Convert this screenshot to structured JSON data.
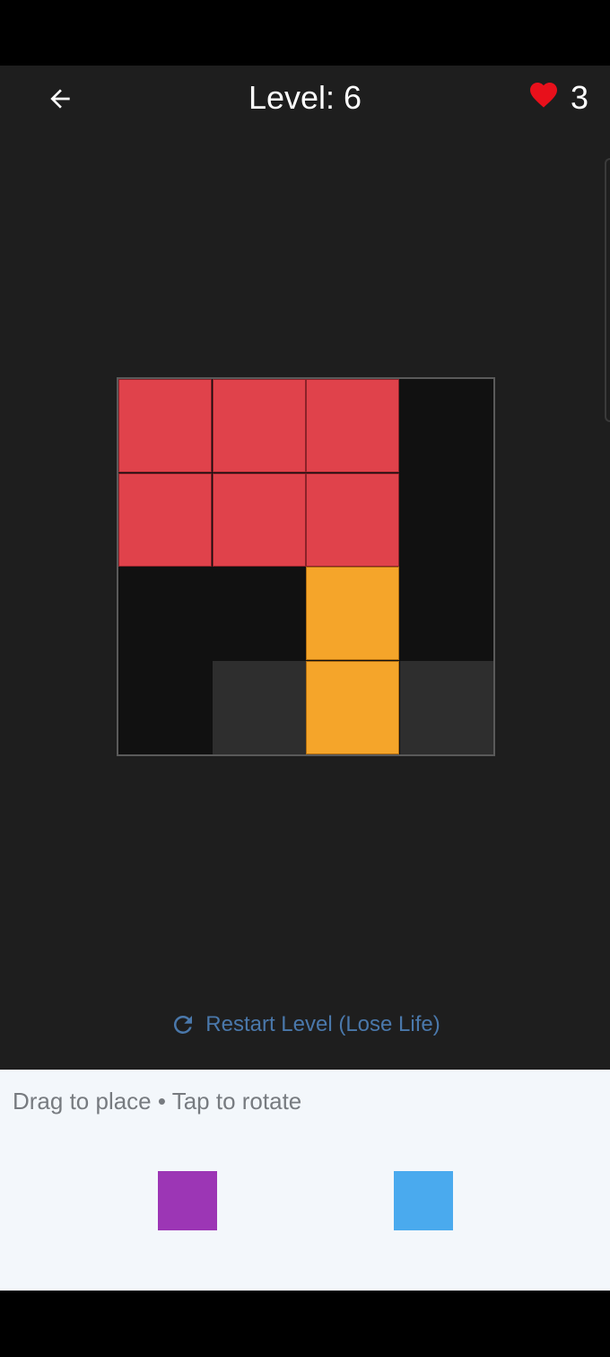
{
  "header": {
    "back_icon": "arrow-left-icon",
    "level_text": "Level: 6",
    "lives_icon": "heart-icon",
    "lives_count": "3"
  },
  "board": {
    "rows": 4,
    "cols": 4,
    "cells": [
      {
        "row": 0,
        "col": 0,
        "state": "red"
      },
      {
        "row": 0,
        "col": 1,
        "state": "red"
      },
      {
        "row": 0,
        "col": 2,
        "state": "red"
      },
      {
        "row": 1,
        "col": 0,
        "state": "red"
      },
      {
        "row": 1,
        "col": 1,
        "state": "red"
      },
      {
        "row": 1,
        "col": 2,
        "state": "red"
      },
      {
        "row": 2,
        "col": 2,
        "state": "orange"
      },
      {
        "row": 3,
        "col": 1,
        "state": "ghost"
      },
      {
        "row": 3,
        "col": 2,
        "state": "orange"
      },
      {
        "row": 3,
        "col": 3,
        "state": "ghost"
      }
    ]
  },
  "restart": {
    "icon": "refresh-icon",
    "label": "Restart Level (Lose Life)"
  },
  "tray": {
    "hint": "Drag to place • Tap to rotate",
    "pieces": [
      {
        "name": "purple-piece",
        "color": "#9c36b5"
      },
      {
        "name": "blue-piece",
        "color": "#4aaaee"
      }
    ]
  },
  "colors": {
    "background": "#1e1e1e",
    "red": "#e0424b",
    "orange": "#f5a52a",
    "ghost": "#2e2e2e",
    "accent": "#4a78ab",
    "heart": "#e8101b"
  }
}
